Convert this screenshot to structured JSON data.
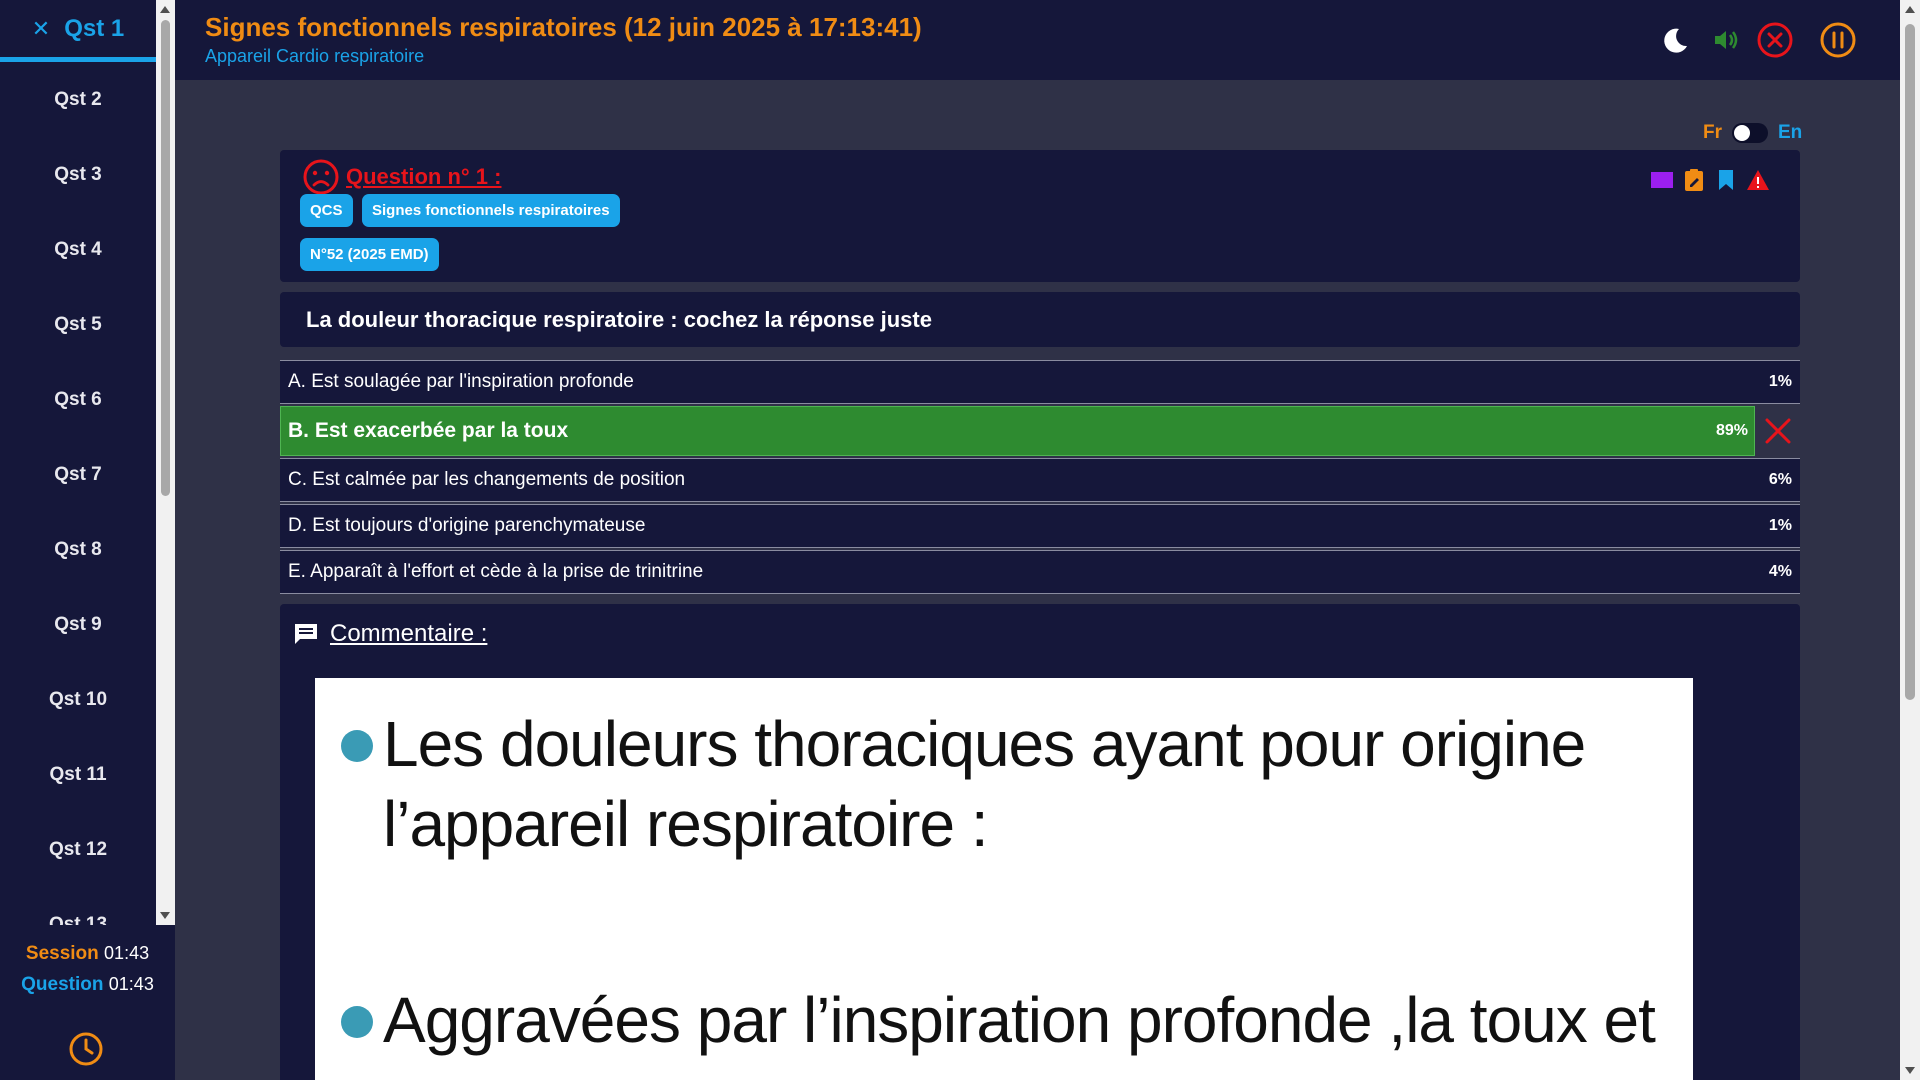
{
  "sidebar": {
    "active_question": "Qst 1",
    "questions": [
      "Qst 2",
      "Qst 3",
      "Qst 4",
      "Qst 5",
      "Qst 6",
      "Qst 7",
      "Qst 8",
      "Qst 9",
      "Qst 10",
      "Qst 11",
      "Qst 12",
      "Qst 13"
    ],
    "timers": {
      "session_label": "Session",
      "session_value": "01:43",
      "question_label": "Question",
      "question_value": "01:43"
    }
  },
  "header": {
    "title": "Signes fonctionnels respiratoires (12 juin 2025 à 17:13:41)",
    "subtitle": "Appareil Cardio respiratoire",
    "icons": [
      "moon-icon",
      "volume-icon",
      "close-circle-icon",
      "pause-circle-icon"
    ]
  },
  "language": {
    "fr": "Fr",
    "en": "En",
    "selected": "Fr"
  },
  "question": {
    "title": "Question n° 1 :",
    "status_icon": "sad-face-icon",
    "tags": [
      "QCS",
      "Signes fonctionnels respiratoires",
      "N°52 (2025 EMD)"
    ],
    "tools": [
      "color-square-icon",
      "edit-clipboard-icon",
      "bookmark-icon",
      "warning-icon"
    ],
    "statement": "La douleur thoracique respiratoire : cochez la réponse juste"
  },
  "answers": [
    {
      "label": "A. Est soulagée par l'inspiration profonde",
      "percent": "1%"
    },
    {
      "label": "B. Est exacerbée par la toux",
      "percent": "89%",
      "correct": true
    },
    {
      "label": "C. Est calmée par les changements de position",
      "percent": "6%"
    },
    {
      "label": "D. Est toujours d'origine parenchymateuse",
      "percent": "1%"
    },
    {
      "label": "E. Apparaît à l'effort et cède à la prise de trinitrine",
      "percent": "4%"
    }
  ],
  "comment": {
    "title": "Commentaire :",
    "slide_lines": [
      "Les douleurs thoraciques ayant pour origine",
      "l’appareil respiratoire :",
      "Aggravées par l’inspiration profonde ,la toux et"
    ]
  },
  "colors": {
    "orange": "#f08c14",
    "blue": "#1aa3e8",
    "red": "#e8141b",
    "green": "#2e8b30",
    "panel": "#15173a",
    "background": "#2f3147"
  }
}
